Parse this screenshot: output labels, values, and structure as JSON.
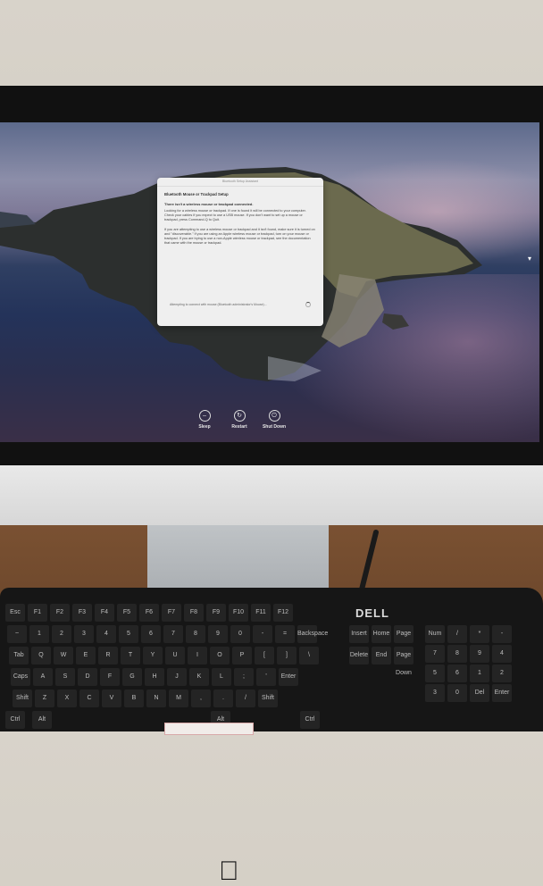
{
  "dialog": {
    "window_title": "Bluetooth Setup Assistant",
    "heading": "Bluetooth Mouse or Trackpad Setup",
    "subheading": "There isn't a wireless mouse or trackpad connected.",
    "paragraph1": "Looking for a wireless mouse or trackpad. If one is found it will be connected to your computer. Check your cables if you expect to use a USB mouse. If you don't want to set up a mouse or trackpad, press Command-Q to Quit.",
    "paragraph2": "If you are attempting to use a wireless mouse or trackpad and it isn't found, make sure it is turned on and \"discoverable.\" If you are using an Apple wireless mouse or trackpad, turn on your mouse or trackpad. If you are trying to use a non-Apple wireless mouse or trackpad, see the documentation that came with the mouse or trackpad.",
    "status": "Attempting to connect with mouse (Bluetooth administrator's Mouse)..."
  },
  "screen_buttons": [
    {
      "label": "Sleep",
      "icon": "sleep-icon"
    },
    {
      "label": "Restart",
      "icon": "restart-icon"
    },
    {
      "label": "Shut Down",
      "icon": "power-icon"
    }
  ],
  "keyboard": {
    "brand": "DELL",
    "keys": [
      "Esc",
      "F1",
      "F2",
      "F3",
      "F4",
      "F5",
      "F6",
      "F7",
      "F8",
      "F9",
      "F10",
      "F11",
      "F12",
      "~",
      "1",
      "2",
      "3",
      "4",
      "5",
      "6",
      "7",
      "8",
      "9",
      "0",
      "-",
      "=",
      "Backspace",
      "Tab",
      "Q",
      "W",
      "E",
      "R",
      "T",
      "Y",
      "U",
      "I",
      "O",
      "P",
      "[",
      "]",
      "\\",
      "Caps",
      "A",
      "S",
      "D",
      "F",
      "G",
      "H",
      "J",
      "K",
      "L",
      ";",
      "'",
      "Enter",
      "Shift",
      "Z",
      "X",
      "C",
      "V",
      "B",
      "N",
      "M",
      ",",
      ".",
      "/",
      "Shift",
      "Ctrl",
      "Alt",
      "Alt",
      "Ctrl",
      "Insert",
      "Home",
      "Page Up",
      "Delete",
      "End",
      "Page Down",
      "Num Lock",
      "/",
      "*",
      "-",
      "7",
      "8",
      "9",
      "4",
      "5",
      "6",
      "1",
      "2",
      "3",
      "0",
      "Del",
      "Enter"
    ]
  },
  "colors": {
    "screen_sky": "#5d6a8c",
    "screen_sea": "#24335a",
    "dialog_bg": "#efefef",
    "desk": "#7a5132"
  }
}
